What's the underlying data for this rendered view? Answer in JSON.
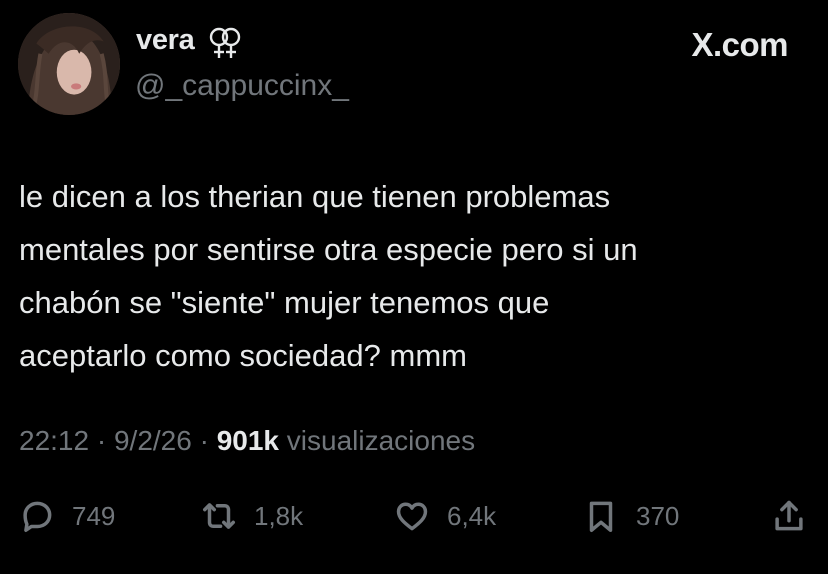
{
  "author": {
    "display_name": "vera",
    "name_symbol_icon": "double-venus-symbol-icon",
    "handle": "@_cappuccinx_"
  },
  "brand": {
    "label": "X.com"
  },
  "tweet": {
    "text": "le dicen a los therian que tienen problemas\nmentales por sentirse otra especie pero si un\nchabón se \"siente\" mujer tenemos que\naceptarlo como sociedad? mmm"
  },
  "meta": {
    "time": "22:12",
    "separator": "·",
    "date": "9/2/26",
    "views_count": "901k",
    "views_label": "visualizaciones"
  },
  "actions": {
    "replies": "749",
    "reposts": "1,8k",
    "likes": "6,4k",
    "bookmarks": "370"
  },
  "colors": {
    "background": "#000000",
    "primary_text": "#e7e9ea",
    "secondary_text": "#71767b"
  }
}
